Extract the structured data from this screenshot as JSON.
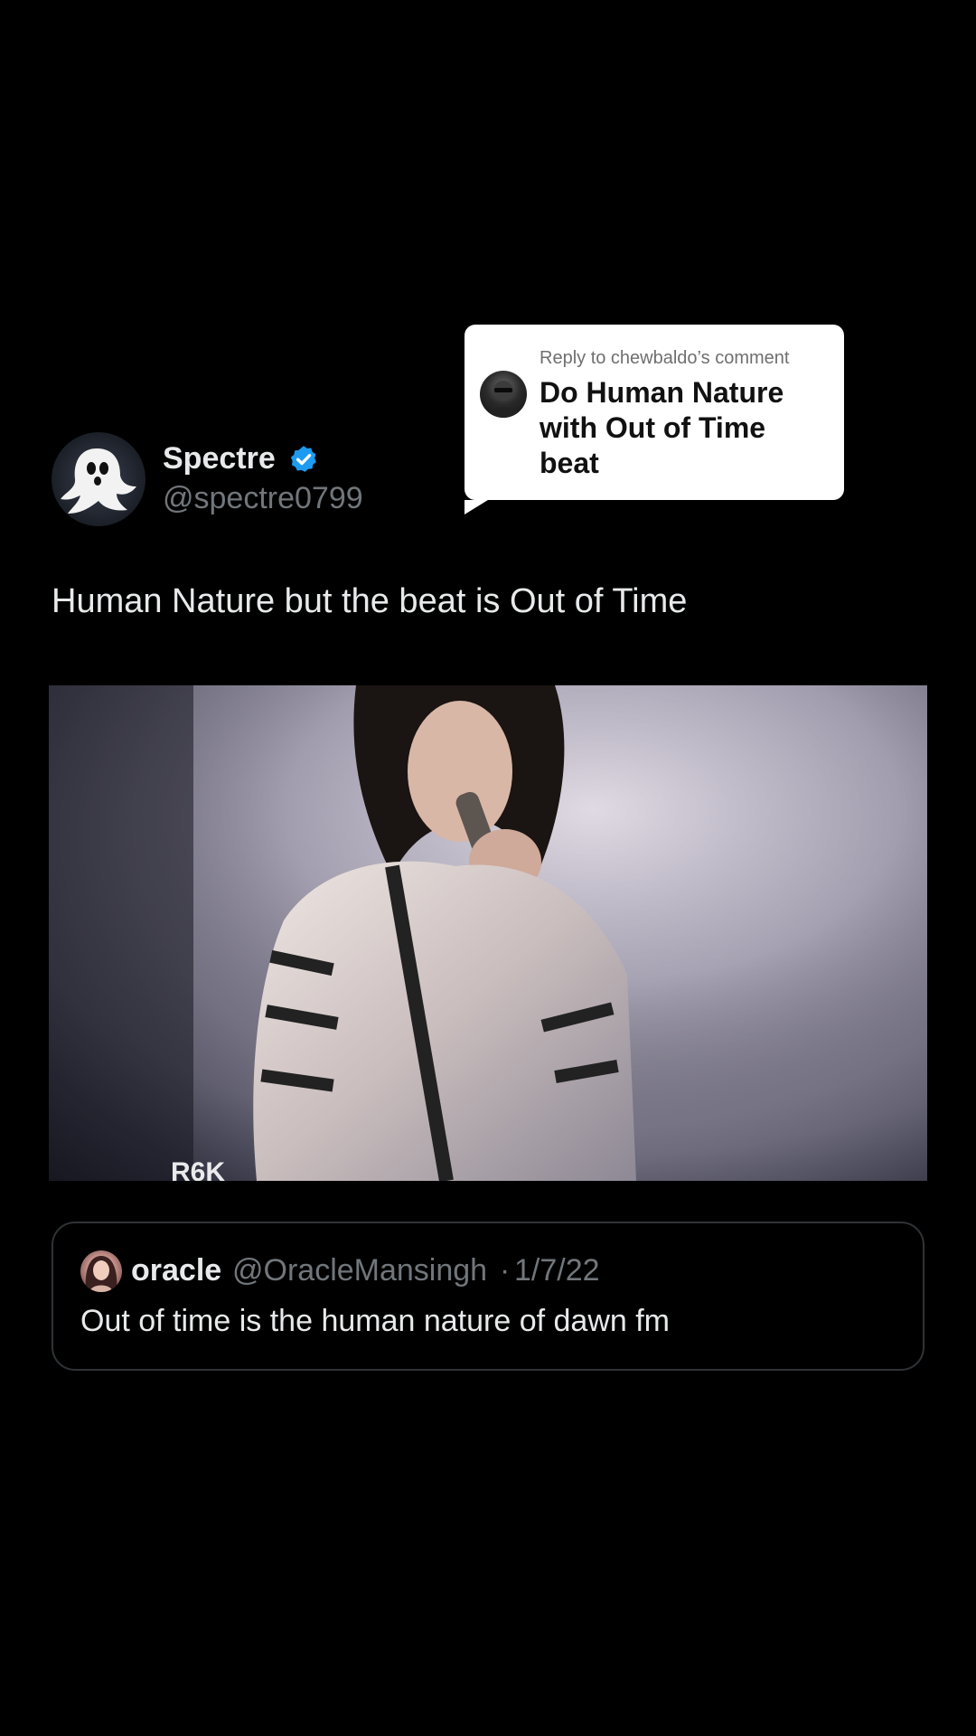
{
  "reply_bubble": {
    "label": "Reply to chewbaldo’s comment",
    "text": "Do Human Nature with Out of Time beat"
  },
  "author": {
    "name": "Spectre",
    "handle": "@spectre0799",
    "verified": true
  },
  "tweet": {
    "text": "Human Nature but the beat is Out of Time"
  },
  "media": {
    "kind": "video-still",
    "overlay_text": "R6K"
  },
  "quote": {
    "name": "oracle",
    "handle": "@OracleMansingh",
    "separator": "·",
    "date": "1/7/22",
    "text": "Out of time is the human nature of dawn fm"
  },
  "colors": {
    "background": "#000000",
    "text_primary": "#e7e9ea",
    "text_secondary": "#71767b",
    "verified_blue": "#1d9bf0",
    "card_border": "#2f3336"
  }
}
